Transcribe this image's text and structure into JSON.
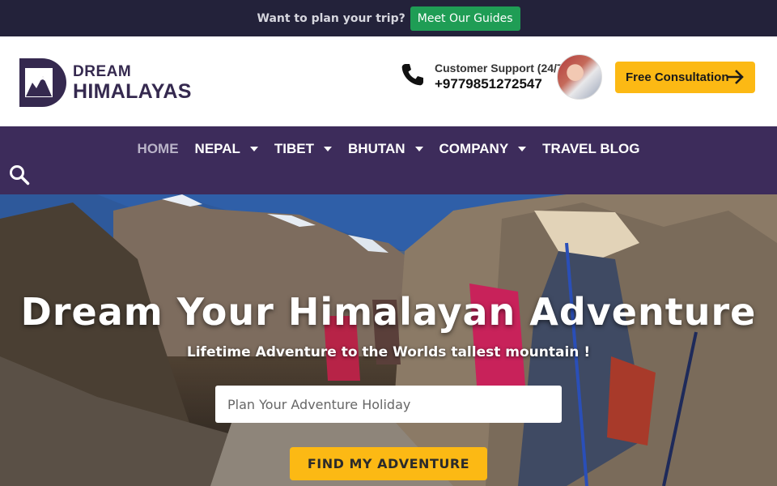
{
  "topbar": {
    "promo_text": "Want to plan your trip?",
    "guides_button": "Meet Our Guides"
  },
  "header": {
    "logo_line1": "DREAM",
    "logo_line2": "HIMALAYAS",
    "support_label": "Customer Support (24/7)",
    "support_number": "+9779851272547",
    "consult_button": "Free Consultation"
  },
  "nav": {
    "items": [
      {
        "label": "HOME",
        "active": true,
        "dropdown": false
      },
      {
        "label": "NEPAL",
        "active": false,
        "dropdown": true
      },
      {
        "label": "TIBET",
        "active": false,
        "dropdown": true
      },
      {
        "label": "BHUTAN",
        "active": false,
        "dropdown": true
      },
      {
        "label": "COMPANY",
        "active": false,
        "dropdown": true
      },
      {
        "label": "TRAVEL BLOG",
        "active": false,
        "dropdown": false
      }
    ]
  },
  "hero": {
    "title": "Dream Your Himalayan Adventure",
    "subtitle": "Lifetime Adventure to the Worlds tallest mountain !",
    "search_placeholder": "Plan Your Adventure Holiday",
    "search_value": "",
    "cta_button": "FIND MY ADVENTURE"
  },
  "colors": {
    "topbar_bg": "#23223a",
    "guides_green": "#1f9d55",
    "brand_purple": "#3d2c5b",
    "accent_yellow": "#fcb914"
  },
  "icons": [
    "phone-icon",
    "arrow-right-icon",
    "search-icon",
    "chevron-down-icon",
    "mountain-logo-icon"
  ]
}
